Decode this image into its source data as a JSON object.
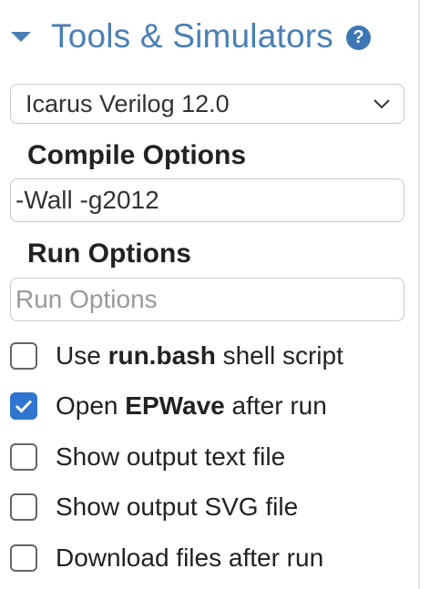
{
  "panel": {
    "title": "Tools & Simulators",
    "help_icon": "question-circle-icon",
    "accent_color": "#4a7fb4"
  },
  "simulator_select": {
    "selected": "Icarus Verilog 12.0"
  },
  "compile_options": {
    "label": "Compile Options",
    "value": "-Wall -g2012"
  },
  "run_options": {
    "label": "Run Options",
    "placeholder": "Run Options",
    "value": ""
  },
  "checkboxes": [
    {
      "pre": "Use ",
      "bold": "run.bash",
      "post": " shell script",
      "checked": false
    },
    {
      "pre": "Open ",
      "bold": "EPWave",
      "post": " after run",
      "checked": true
    },
    {
      "pre": "Show output text file",
      "bold": "",
      "post": "",
      "checked": false
    },
    {
      "pre": "Show output SVG file",
      "bold": "",
      "post": "",
      "checked": false
    },
    {
      "pre": "Download files after run",
      "bold": "",
      "post": "",
      "checked": false
    }
  ],
  "checkbox_color": "#2f74d0"
}
